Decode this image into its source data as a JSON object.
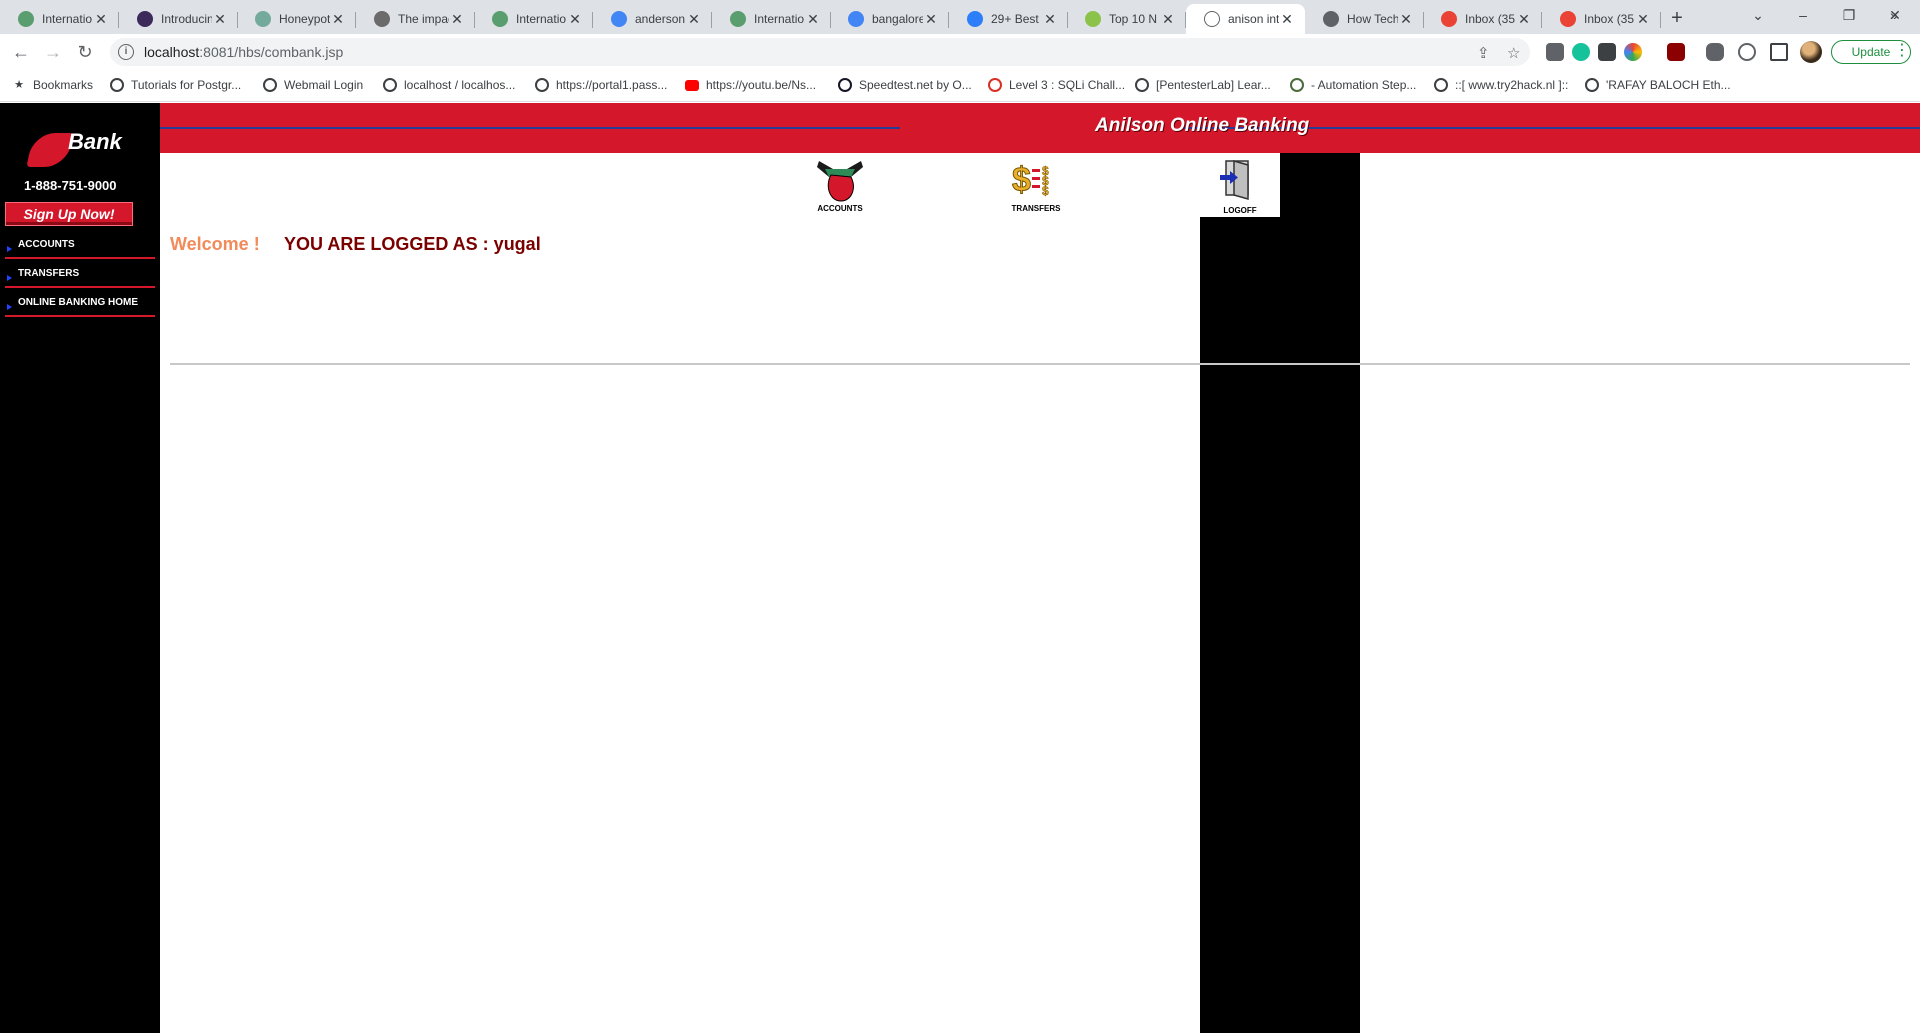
{
  "browser": {
    "tabs": [
      {
        "title": "Internatio",
        "icon": "globe-icon",
        "color": "#5a9e6f"
      },
      {
        "title": "Introducin",
        "icon": "app-icon",
        "color": "#3b2a5a"
      },
      {
        "title": "Honeypot",
        "icon": "chatgpt-icon",
        "color": "#74aa9c"
      },
      {
        "title": "The impac",
        "icon": "play-icon",
        "color": "#6b6b6b"
      },
      {
        "title": "Internatio",
        "icon": "globe-icon",
        "color": "#5a9e6f"
      },
      {
        "title": "anderson",
        "icon": "google-icon",
        "color": "#4285f4"
      },
      {
        "title": "Internatio",
        "icon": "globe-icon",
        "color": "#5a9e6f"
      },
      {
        "title": "bangalore",
        "icon": "google-icon",
        "color": "#4285f4"
      },
      {
        "title": "29+ Best",
        "icon": "chat-icon",
        "color": "#2d7ff9"
      },
      {
        "title": "Top 10 N",
        "icon": "circle-icon",
        "color": "#8bc34a"
      },
      {
        "title": "anison int",
        "icon": "page-icon",
        "color": "#ffffff",
        "active": true
      },
      {
        "title": "How Tech",
        "icon": "globe-icon",
        "color": "#5f6368"
      },
      {
        "title": "Inbox (35",
        "icon": "gmail-icon",
        "color": "#ea4335"
      },
      {
        "title": "Inbox (35",
        "icon": "gmail-icon",
        "color": "#ea4335"
      }
    ],
    "url_host": "localhost",
    "url_rest": ":8081/hbs/combank.jsp",
    "update_label": "Update",
    "bookmarks": [
      {
        "label": "Bookmarks",
        "icon": "star-icon"
      },
      {
        "label": "Tutorials for Postgr...",
        "icon": "diamond-icon"
      },
      {
        "label": "Webmail Login",
        "icon": "globe-icon"
      },
      {
        "label": "localhost / localhos...",
        "icon": "globe-icon"
      },
      {
        "label": "https://portal1.pass...",
        "icon": "globe-icon"
      },
      {
        "label": "https://youtu.be/Ns...",
        "icon": "youtube-icon"
      },
      {
        "label": "Speedtest.net by O...",
        "icon": "speedtest-icon"
      },
      {
        "label": "Level 3 : SQLi Chall...",
        "icon": "bug-icon"
      },
      {
        "label": "[PentesterLab] Lear...",
        "icon": "pen-icon"
      },
      {
        "label": "- Automation Step...",
        "icon": "tree-icon"
      },
      {
        "label": "::[ www.try2hack.nl ]::",
        "icon": "globe-icon"
      },
      {
        "label": "'RAFAY BALOCH Eth...",
        "icon": "globe-icon"
      }
    ]
  },
  "site": {
    "logo_text": "Bank",
    "phone": "1-888-751-9000",
    "signup_label": "Sign Up Now!",
    "nav": [
      "ACCOUNTS",
      "TRANSFERS",
      "ONLINE BANKING HOME"
    ],
    "banner_title": "Anilson  Online Banking",
    "icons": {
      "accounts": "ACCOUNTS",
      "transfers": "TRANSFERS",
      "logoff": "LOGOFF"
    },
    "welcome": "Welcome !",
    "logged_as": "YOU ARE LOGGED AS :  yugal"
  },
  "colors": {
    "brand_red": "#d4172b",
    "banner_line": "#2a3c99",
    "welcome": "#f28a5a",
    "logged": "#7a0000"
  }
}
